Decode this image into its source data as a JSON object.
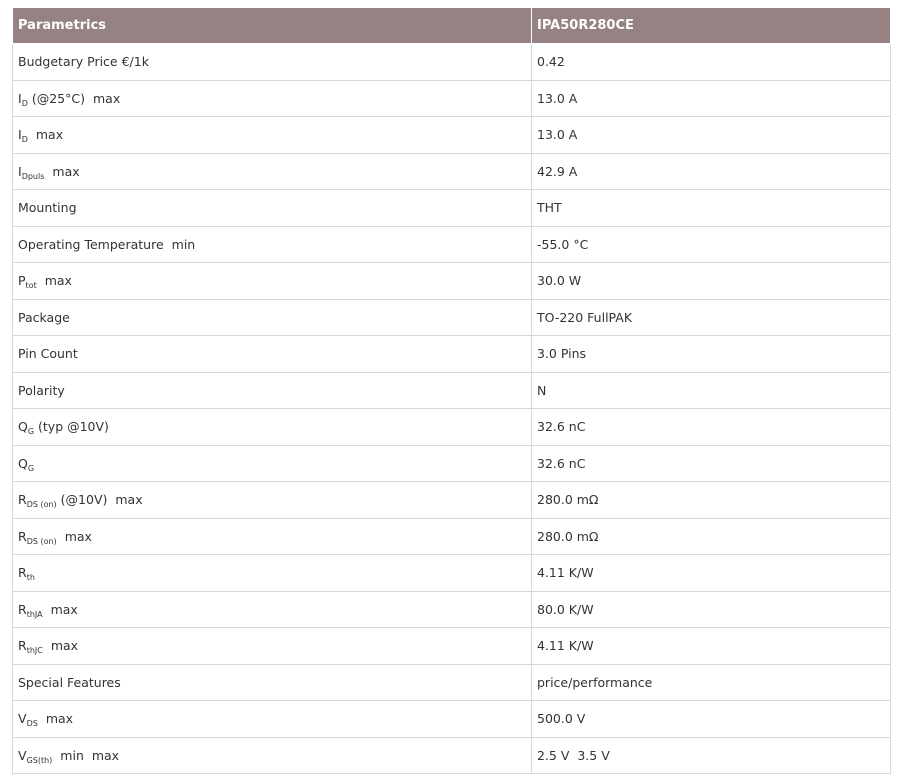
{
  "header": {
    "col1": "Parametrics",
    "col2": "IPA50R280CE"
  },
  "rows": [
    {
      "sym": "Budgetary Price €/1k",
      "sub": "",
      "rest": "",
      "qual": "",
      "value": "0.42"
    },
    {
      "sym": "I",
      "sub": "D",
      "rest": " (@25°C)",
      "qual": "max",
      "value": "13.0 A"
    },
    {
      "sym": "I",
      "sub": "D",
      "rest": "",
      "qual": "max",
      "value": "13.0 A"
    },
    {
      "sym": "I",
      "sub": "Dpuls",
      "rest": "",
      "qual": "max",
      "value": "42.9 A"
    },
    {
      "sym": "Mounting",
      "sub": "",
      "rest": "",
      "qual": "",
      "value": "THT"
    },
    {
      "sym": "Operating Temperature",
      "sub": "",
      "rest": "",
      "qual": "min",
      "value": "-55.0 °C"
    },
    {
      "sym": "P",
      "sub": "tot",
      "rest": "",
      "qual": "max",
      "value": "30.0 W"
    },
    {
      "sym": "Package",
      "sub": "",
      "rest": "",
      "qual": "",
      "value": "TO-220 FullPAK"
    },
    {
      "sym": "Pin Count",
      "sub": "",
      "rest": "",
      "qual": "",
      "value": "3.0 Pins"
    },
    {
      "sym": "Polarity",
      "sub": "",
      "rest": "",
      "qual": "",
      "value": "N"
    },
    {
      "sym": "Q",
      "sub": "G",
      "rest": " (typ @10V)",
      "qual": "",
      "value": "32.6 nC"
    },
    {
      "sym": "Q",
      "sub": "G",
      "rest": "",
      "qual": "",
      "value": "32.6 nC"
    },
    {
      "sym": "R",
      "sub": "DS (on)",
      "rest": " (@10V)",
      "qual": "max",
      "value": "280.0 mΩ"
    },
    {
      "sym": "R",
      "sub": "DS (on)",
      "rest": "",
      "qual": "max",
      "value": "280.0 mΩ"
    },
    {
      "sym": "R",
      "sub": "th",
      "rest": "",
      "qual": "",
      "value": "4.11 K/W"
    },
    {
      "sym": "R",
      "sub": "thJA",
      "rest": "",
      "qual": "max",
      "value": "80.0 K/W"
    },
    {
      "sym": "R",
      "sub": "thJC",
      "rest": "",
      "qual": "max",
      "value": "4.11 K/W"
    },
    {
      "sym": "Special Features",
      "sub": "",
      "rest": "",
      "qual": "",
      "value": "price/performance"
    },
    {
      "sym": "V",
      "sub": "DS",
      "rest": "",
      "qual": "max",
      "value": "500.0 V"
    },
    {
      "sym": "V",
      "sub": "GS(th)",
      "rest": "",
      "qual": "min  max",
      "value": "2.5 V  3.5 V"
    }
  ]
}
